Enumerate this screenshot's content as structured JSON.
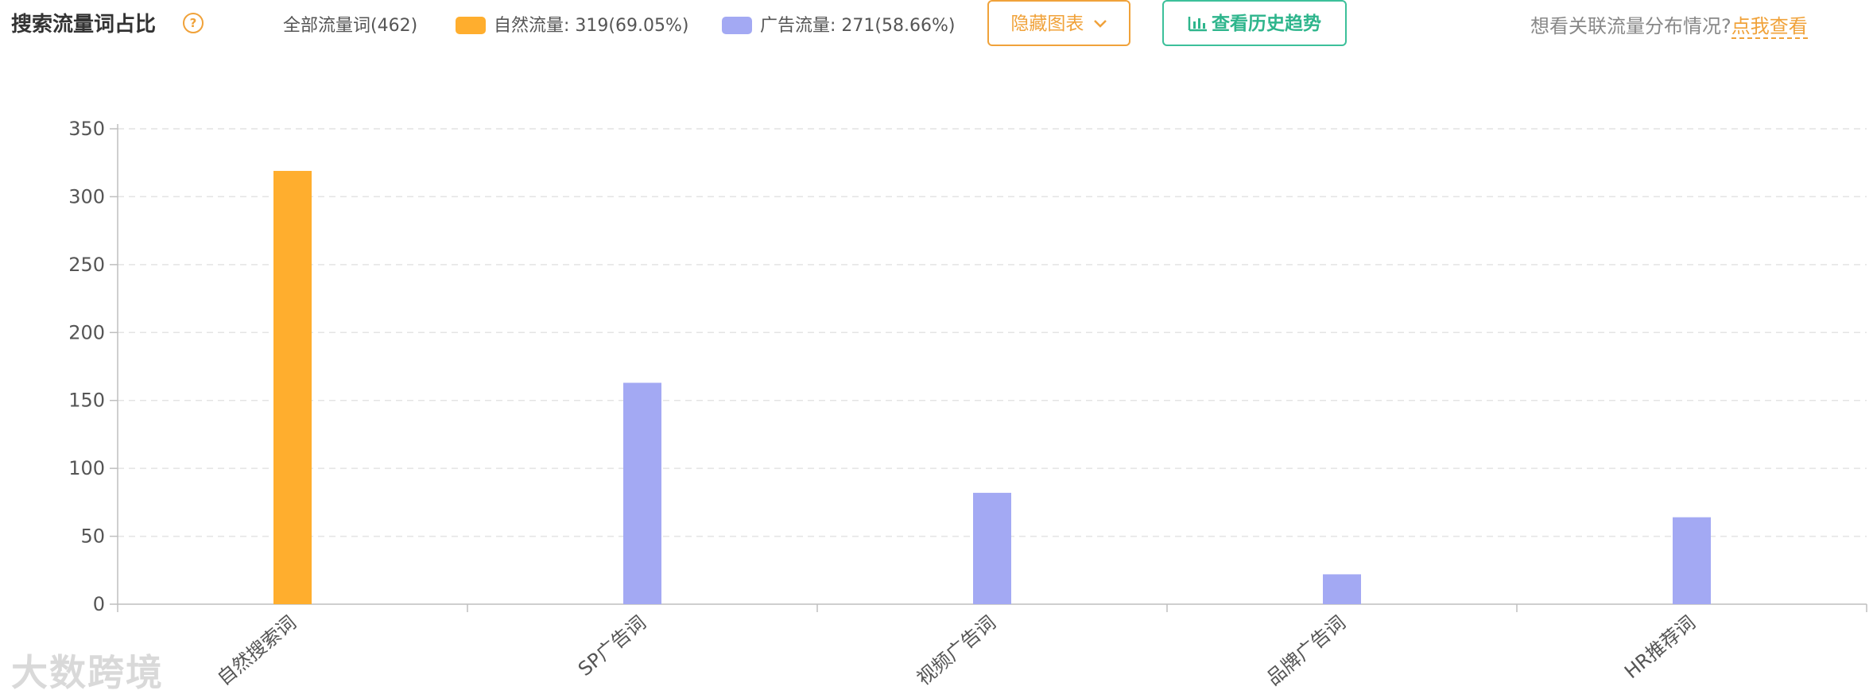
{
  "header": {
    "title": "搜索流量词占比",
    "help_icon": "?",
    "all_label": "全部流量词(462)",
    "legend": [
      {
        "label": "自然流量: 319(69.05%)",
        "color": "#FFAE2E"
      },
      {
        "label": "广告流量: 271(58.66%)",
        "color": "#A3A9F3"
      }
    ],
    "hide_button": "隐藏图表",
    "trend_button": "查看历史趋势",
    "right_prompt": "想看关联流量分布情况?",
    "right_link": "点我查看"
  },
  "watermark": "大数跨境",
  "chart_data": {
    "type": "bar",
    "categories": [
      "自然搜索词",
      "SP广告词",
      "视频广告词",
      "品牌广告词",
      "HR推荐词"
    ],
    "values": [
      319,
      163,
      82,
      22,
      64
    ],
    "colors": [
      "#FFAE2E",
      "#A3A9F3",
      "#A3A9F3",
      "#A3A9F3",
      "#A3A9F3"
    ],
    "ylim": [
      0,
      350
    ],
    "yticks": [
      0,
      50,
      100,
      150,
      200,
      250,
      300,
      350
    ],
    "grid": true,
    "title": "",
    "xlabel": "",
    "ylabel": ""
  }
}
